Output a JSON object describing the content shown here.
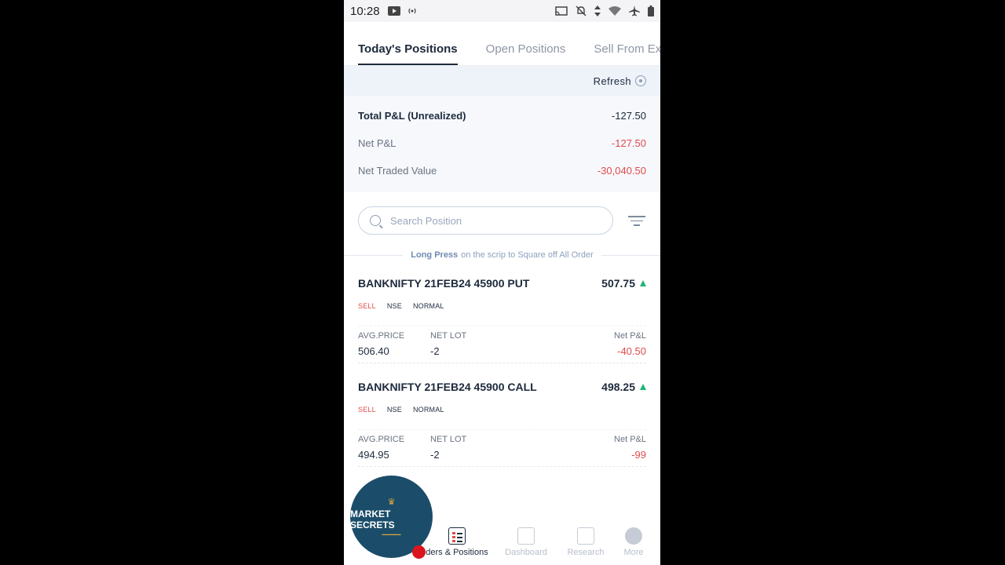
{
  "status": {
    "time": "10:28",
    "left_icons": [
      "youtube-icon",
      "broadcast-icon"
    ],
    "right_icons": [
      "cast-icon",
      "mute-icon",
      "data-arrows-icon",
      "wifi-icon",
      "airplane-icon",
      "battery-icon"
    ]
  },
  "tabs": [
    {
      "label": "Today's Positions",
      "active": true
    },
    {
      "label": "Open Positions",
      "active": false
    },
    {
      "label": "Sell From Ex",
      "active": false
    }
  ],
  "refresh_label": "Refresh",
  "summary": {
    "total_label": "Total P&L (Unrealized)",
    "total_value": "-127.50",
    "net_pl_label": "Net P&L",
    "net_pl_value": "-127.50",
    "ntv_label": "Net Traded Value",
    "ntv_value": "-30,040.50"
  },
  "search": {
    "placeholder": "Search Position"
  },
  "hint": {
    "bold": "Long Press",
    "rest": "on the scrip to Square off All Order"
  },
  "positions": [
    {
      "name": "BANKNIFTY 21FEB24 45900 PUT",
      "ltp": "507.75",
      "side": "SELL",
      "exchange": "NSE",
      "product": "NORMAL",
      "avg_label": "AVG.PRICE",
      "avg": "506.40",
      "lot_label": "NET LOT",
      "lot": "-2",
      "pnl_label": "Net P&L",
      "pnl": "-40.50"
    },
    {
      "name": "BANKNIFTY 21FEB24 45900 CALL",
      "ltp": "498.25",
      "side": "SELL",
      "exchange": "NSE",
      "product": "NORMAL",
      "avg_label": "AVG.PRICE",
      "avg": "494.95",
      "lot_label": "NET LOT",
      "lot": "-2",
      "pnl_label": "Net P&L",
      "pnl": "-99"
    }
  ],
  "bottom_nav": [
    {
      "label": "ders & Positions",
      "active": true
    },
    {
      "label": "Dashboard",
      "active": false
    },
    {
      "label": "Research",
      "active": false
    },
    {
      "label": "More",
      "active": false
    }
  ],
  "overlay_logo": {
    "brand": "MARKET SECRETS"
  },
  "colors": {
    "negative": "#e14b4b",
    "positive": "#1fb576",
    "primary": "#1d2a3c"
  }
}
